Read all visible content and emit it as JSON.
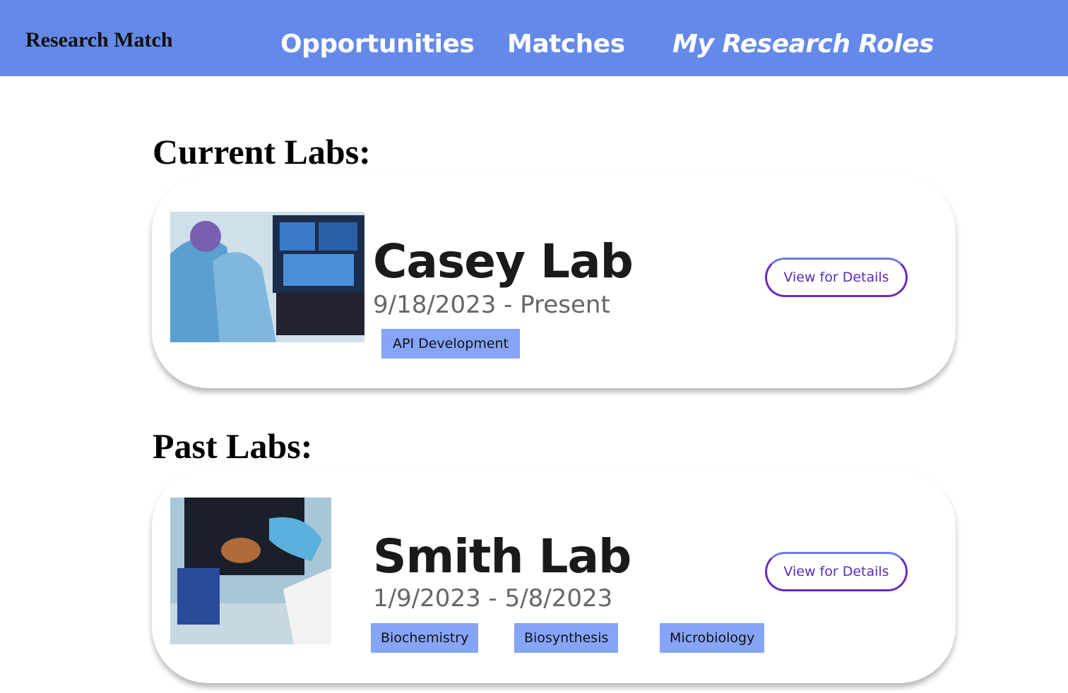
{
  "nav": {
    "brand": "Research Match",
    "links": [
      "Opportunities",
      "Matches",
      "My Research Roles"
    ]
  },
  "current": {
    "heading": "Current Labs:",
    "labs": [
      {
        "name": "Casey Lab",
        "dates": "9/18/2023 - Present",
        "tags": [
          "API Development"
        ],
        "button": "View for Details"
      }
    ]
  },
  "past": {
    "heading": "Past Labs:",
    "labs": [
      {
        "name": "Smith Lab",
        "dates": "1/9/2023 - 5/8/2023",
        "tags": [
          "Biochemistry",
          "Biosynthesis",
          "Microbiology"
        ],
        "button": "View for Details"
      }
    ]
  }
}
